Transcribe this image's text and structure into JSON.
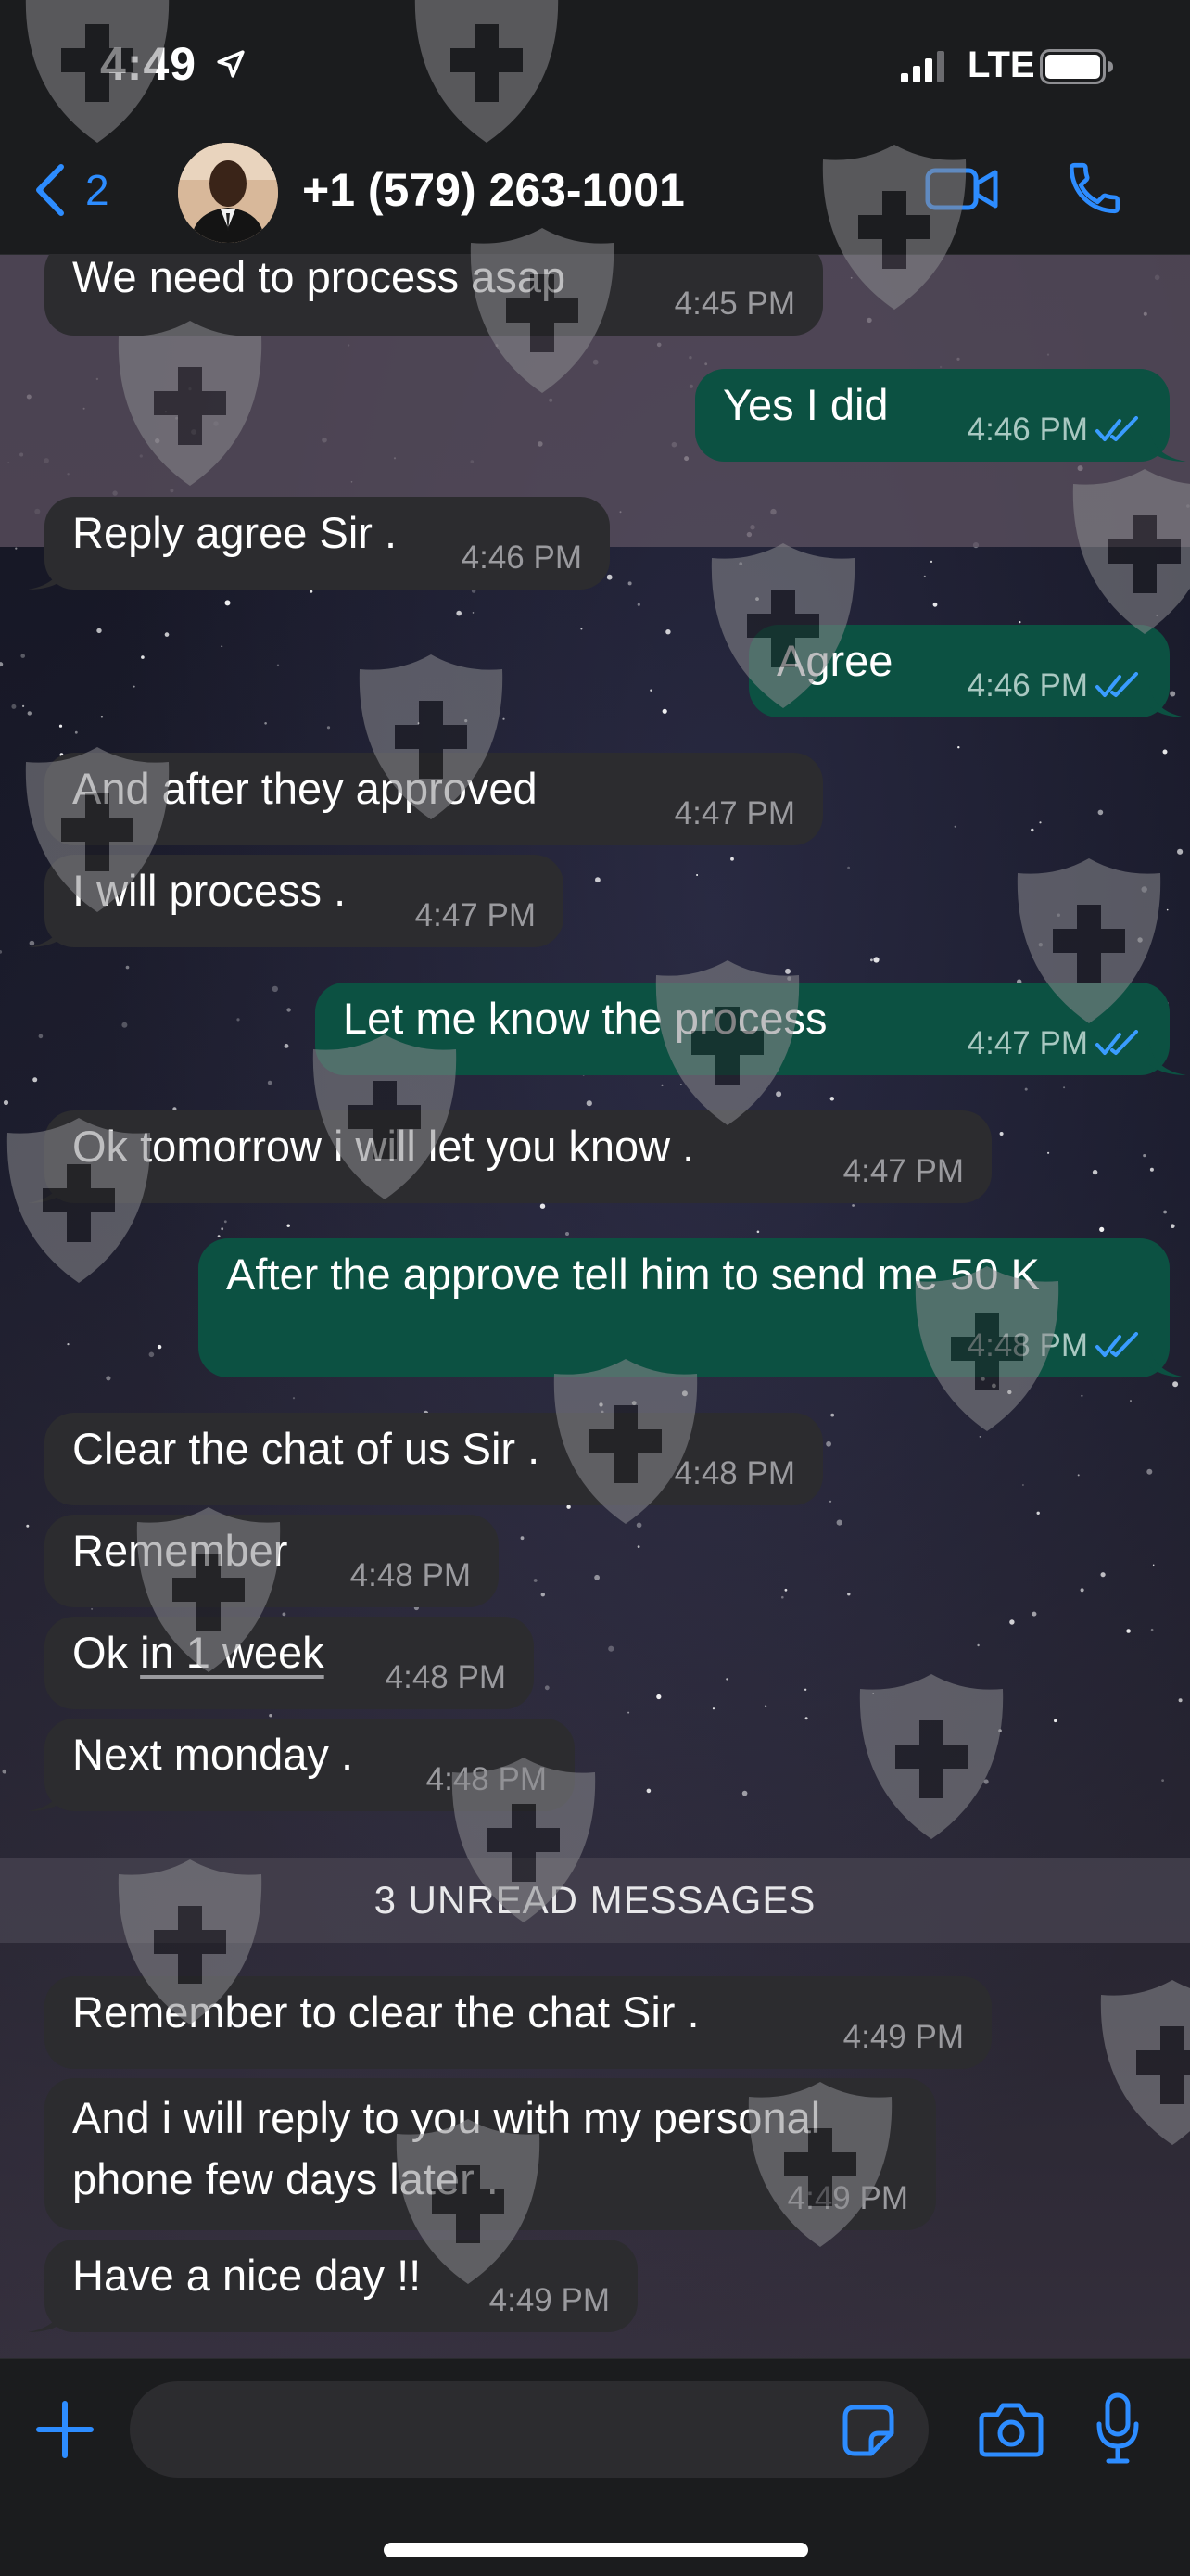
{
  "status_bar": {
    "time": "4:49",
    "network": "LTE"
  },
  "header": {
    "back_count": "2",
    "contact_name": "+1 (579) 263-1001",
    "accent_color": "#2d8cff"
  },
  "messages": [
    {
      "direction": "incoming",
      "text": "We need to process asap",
      "time": "4:45 PM"
    },
    {
      "direction": "outgoing",
      "text": "Yes I did",
      "time": "4:46 PM",
      "read": true
    },
    {
      "direction": "incoming",
      "text": "Reply agree Sir .",
      "time": "4:46 PM"
    },
    {
      "direction": "outgoing",
      "text": "Agree",
      "time": "4:46 PM",
      "read": true
    },
    {
      "direction": "incoming",
      "text": "And after they approved",
      "time": "4:47 PM"
    },
    {
      "direction": "incoming",
      "text": "I will process .",
      "time": "4:47 PM"
    },
    {
      "direction": "outgoing",
      "text": "Let me know the process",
      "time": "4:47 PM",
      "read": true
    },
    {
      "direction": "incoming",
      "text": "Ok tomorrow i will let you know .",
      "time": "4:47 PM"
    },
    {
      "direction": "outgoing",
      "text": "After the approve tell him to send me 50 K",
      "time": "4:48 PM",
      "read": true
    },
    {
      "direction": "incoming",
      "text": "Clear the chat of us Sir .",
      "time": "4:48 PM"
    },
    {
      "direction": "incoming",
      "text": "Remember",
      "time": "4:48 PM"
    },
    {
      "direction": "incoming",
      "text_prefix": "Ok ",
      "text_link": "in 1 week",
      "time": "4:48 PM"
    },
    {
      "direction": "incoming",
      "text": "Next monday .",
      "time": "4:48 PM"
    },
    {
      "direction": "incoming",
      "text": "Remember to clear the chat Sir .",
      "time": "4:49 PM"
    },
    {
      "direction": "incoming",
      "text": "And i will reply to you with my personal phone few days later .",
      "time": "4:49 PM"
    },
    {
      "direction": "incoming",
      "text": "Have a nice day !!",
      "time": "4:49 PM"
    }
  ],
  "unread_banner": "3 UNREAD MESSAGES",
  "colors": {
    "incoming_bubble": "#2c2c2f",
    "outgoing_bubble": "#0c5142",
    "read_ticks": "#3a9cff"
  }
}
